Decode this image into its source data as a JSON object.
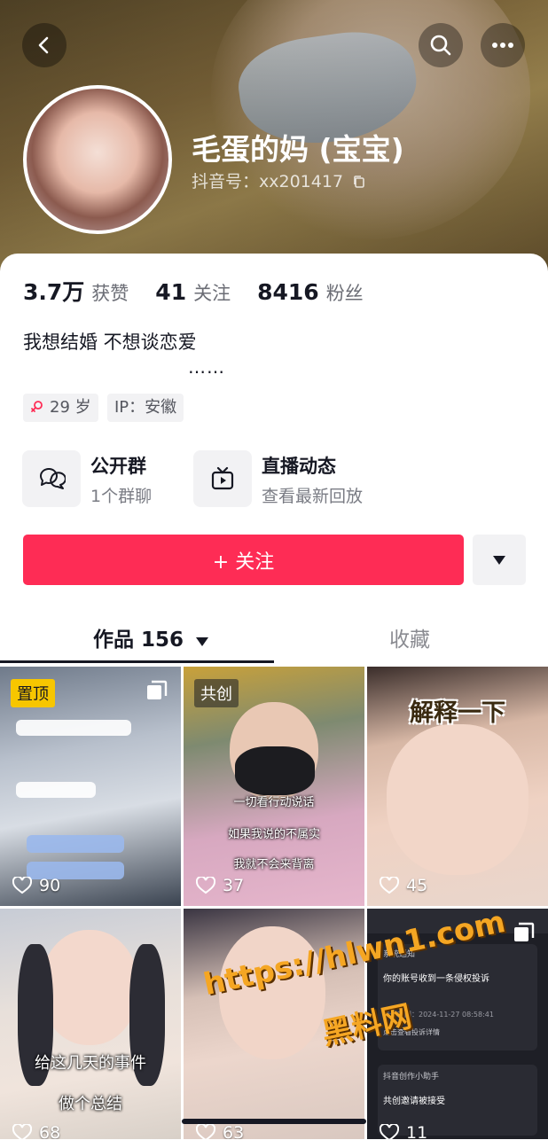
{
  "header": {
    "name": "毛蛋的妈 (宝宝)",
    "douyin_id_label": "抖音号：",
    "douyin_id": "xx201417"
  },
  "stats": [
    {
      "value": "3.7万",
      "label": "获赞"
    },
    {
      "value": "41",
      "label": "关注"
    },
    {
      "value": "8416",
      "label": "粉丝"
    }
  ],
  "bio": "我想结婚 不想谈恋爱",
  "bio_more": "……",
  "tags": {
    "age": "29 岁",
    "ip": "IP：安徽"
  },
  "features": [
    {
      "title": "公开群",
      "subtitle": "1个群聊"
    },
    {
      "title": "直播动态",
      "subtitle": "查看最新回放"
    }
  ],
  "follow_button": "+ 关注",
  "tabs": [
    {
      "label": "作品 156",
      "active": true
    },
    {
      "label": "收藏",
      "active": false
    }
  ],
  "videos": [
    {
      "badge": "置顶",
      "likes": "90"
    },
    {
      "badge": "共创",
      "likes": "37",
      "captions": [
        "一切看行动说话",
        "如果我说的不属实",
        "我就不会来背离"
      ]
    },
    {
      "title": "解释一下",
      "likes": "45"
    },
    {
      "captions": [
        "给这几天的事件",
        "做个总结"
      ],
      "likes": "68"
    },
    {
      "likes": "63"
    },
    {
      "likes": "11",
      "notice_lines": [
        "系统通知",
        "你的账号收到一条侵权投诉",
        "投诉时间：2024-11-27 08:58:41",
        "点击查看投诉详情",
        "抖音创作小助手",
        "共创邀请被接受"
      ]
    }
  ],
  "watermark": {
    "line1": "https://hlwn1.com",
    "line2": "黑料网"
  },
  "colors": {
    "accent": "#fe2c55",
    "badge_yellow": "#f7c600"
  }
}
